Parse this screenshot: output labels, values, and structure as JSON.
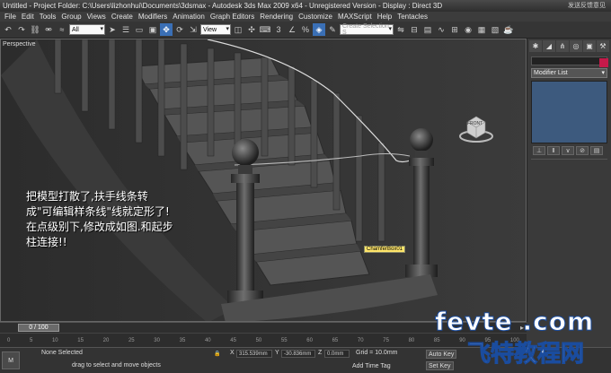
{
  "titlebar": {
    "title": "Untitled    - Project Folder: C:\\Users\\lizhonhui\\Documents\\3dsmax    - Autodesk 3ds Max  2009 x64  - Unregistered Version    - Display : Direct 3D",
    "watermark_top": "发送反馈意见"
  },
  "menu": [
    "File",
    "Edit",
    "Tools",
    "Group",
    "Views",
    "Create",
    "Modifiers",
    "Animation",
    "Graph Editors",
    "Rendering",
    "Customize",
    "MAXScript",
    "Help",
    "Tentacles"
  ],
  "toolbar": {
    "filter_value": "All",
    "ref_coord_value": "View",
    "selection_set_placeholder": "Create Selection S"
  },
  "viewport": {
    "label": "Perspective",
    "annotation_lines": [
      "把模型打散了,扶手线条转",
      "成\"可编辑样条线\"线就定形了!",
      "在点级别下,修改成如图.和起步",
      "柱连接!!"
    ],
    "object_tag": "ChamferBox01",
    "viewcube_label": "FRONT"
  },
  "command_panel": {
    "modifier_list_label": "Modifier List",
    "color_swatch": "#c51a4a"
  },
  "timeline": {
    "frame_display": "0 / 100",
    "ticks": [
      "0",
      "5",
      "10",
      "15",
      "20",
      "25",
      "30",
      "35",
      "40",
      "45",
      "50",
      "55",
      "60",
      "65",
      "70",
      "75",
      "80",
      "85",
      "90",
      "95",
      "100"
    ]
  },
  "status": {
    "max_button": "M",
    "selection_status": "None Selected",
    "prompt": "drag to select and move objects",
    "x_label": "X",
    "x_value": "315.539mm",
    "y_label": "Y",
    "y_value": "-30.836mm",
    "z_label": "Z",
    "z_value": "0.0mm",
    "grid": "Grid = 10.0mm",
    "add_time_tag": "Add Time Tag",
    "auto_key": "Auto Key",
    "set_key": "Set Key"
  },
  "watermark": {
    "line1": "fevte .com",
    "line2": "飞特教程网"
  }
}
